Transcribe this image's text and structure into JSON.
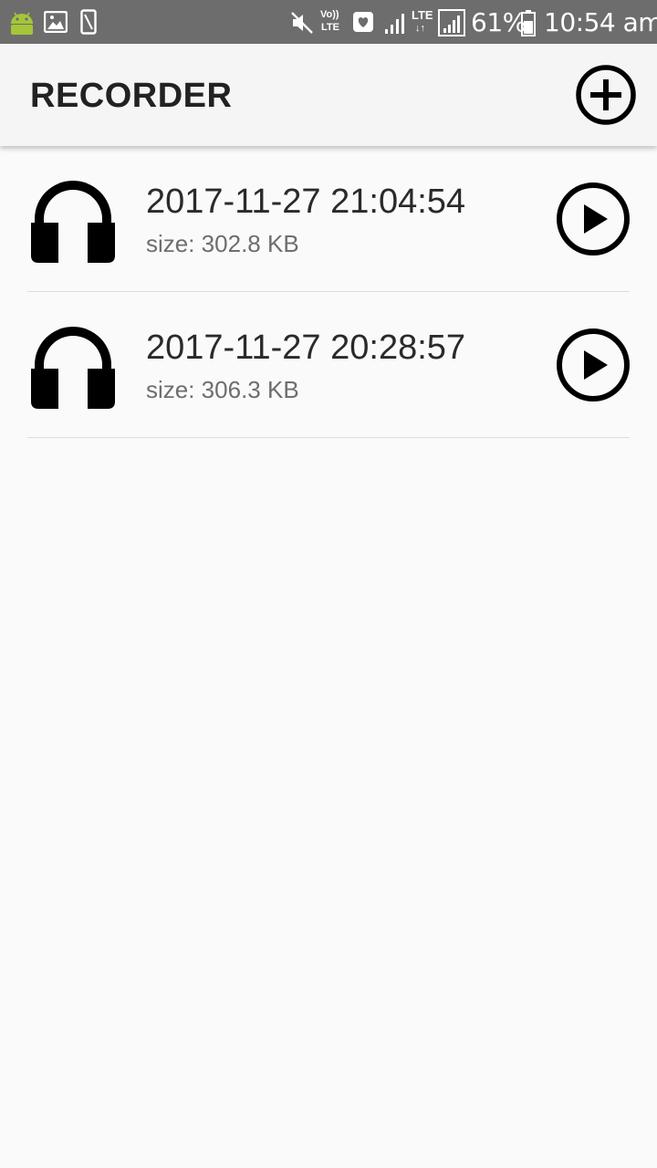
{
  "status_bar": {
    "battery": "61%",
    "time": "10:54 am",
    "icons": [
      "android-icon",
      "image-icon",
      "phone-frame-icon",
      "mute-icon",
      "volte-icon",
      "heart-message-icon",
      "signal-icon",
      "lte-icon",
      "signal-icon",
      "battery-icon"
    ],
    "volte_label": "Vo))",
    "volte_sub": "LTE",
    "lte_label": "LTE"
  },
  "app_bar": {
    "title": "RECORDER",
    "add_icon": "add-circle-icon"
  },
  "recordings": [
    {
      "title": "2017-11-27 21:04:54",
      "size": "size: 302.8 KB",
      "icon": "headphones-icon",
      "action_icon": "play-circle-icon"
    },
    {
      "title": "2017-11-27 20:28:57",
      "size": "size: 306.3 KB",
      "icon": "headphones-icon",
      "action_icon": "play-circle-icon"
    }
  ],
  "colors": {
    "status_bar": "#6d6d6d",
    "app_bar": "#f5f5f5",
    "background": "#fafafa",
    "icon": "#000000",
    "android_green": "#a4c639"
  }
}
